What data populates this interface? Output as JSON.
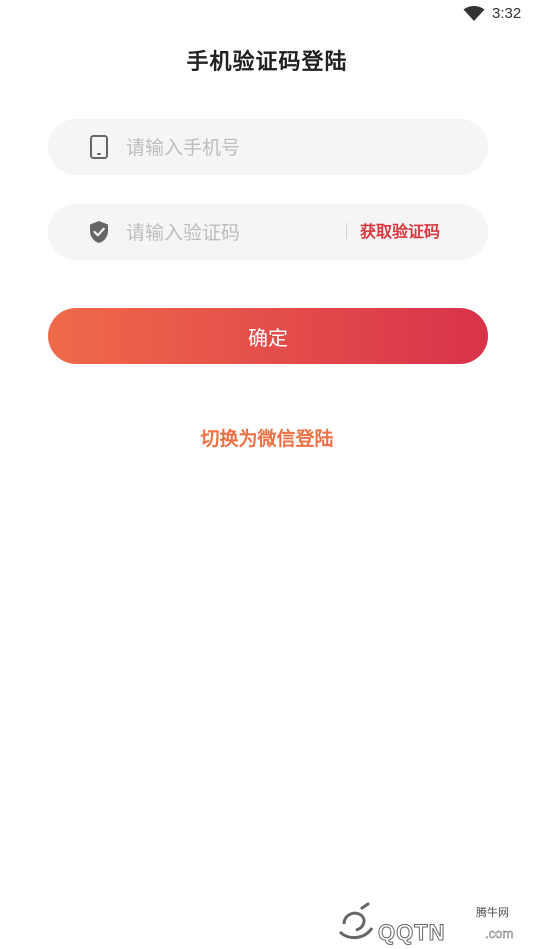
{
  "status_bar": {
    "time": "3:32"
  },
  "page": {
    "title": "手机验证码登陆"
  },
  "phone_field": {
    "placeholder": "请输入手机号",
    "value": ""
  },
  "code_field": {
    "placeholder": "请输入验证码",
    "value": "",
    "get_code_label": "获取验证码"
  },
  "confirm_button": {
    "label": "确定"
  },
  "switch_link": {
    "label": "切换为微信登陆"
  },
  "watermark": {
    "chinese": "腾牛网",
    "text": "QQTN",
    "suffix": ".com"
  },
  "colors": {
    "accent_start": "#ef6a4a",
    "accent_end": "#d8334a",
    "get_code": "#d9383f",
    "switch_link": "#ee7045",
    "field_bg": "#f5f5f5"
  },
  "icons": {
    "status": "wifi-icon",
    "phone_field": "phone-icon",
    "code_field": "shield-check-icon"
  }
}
